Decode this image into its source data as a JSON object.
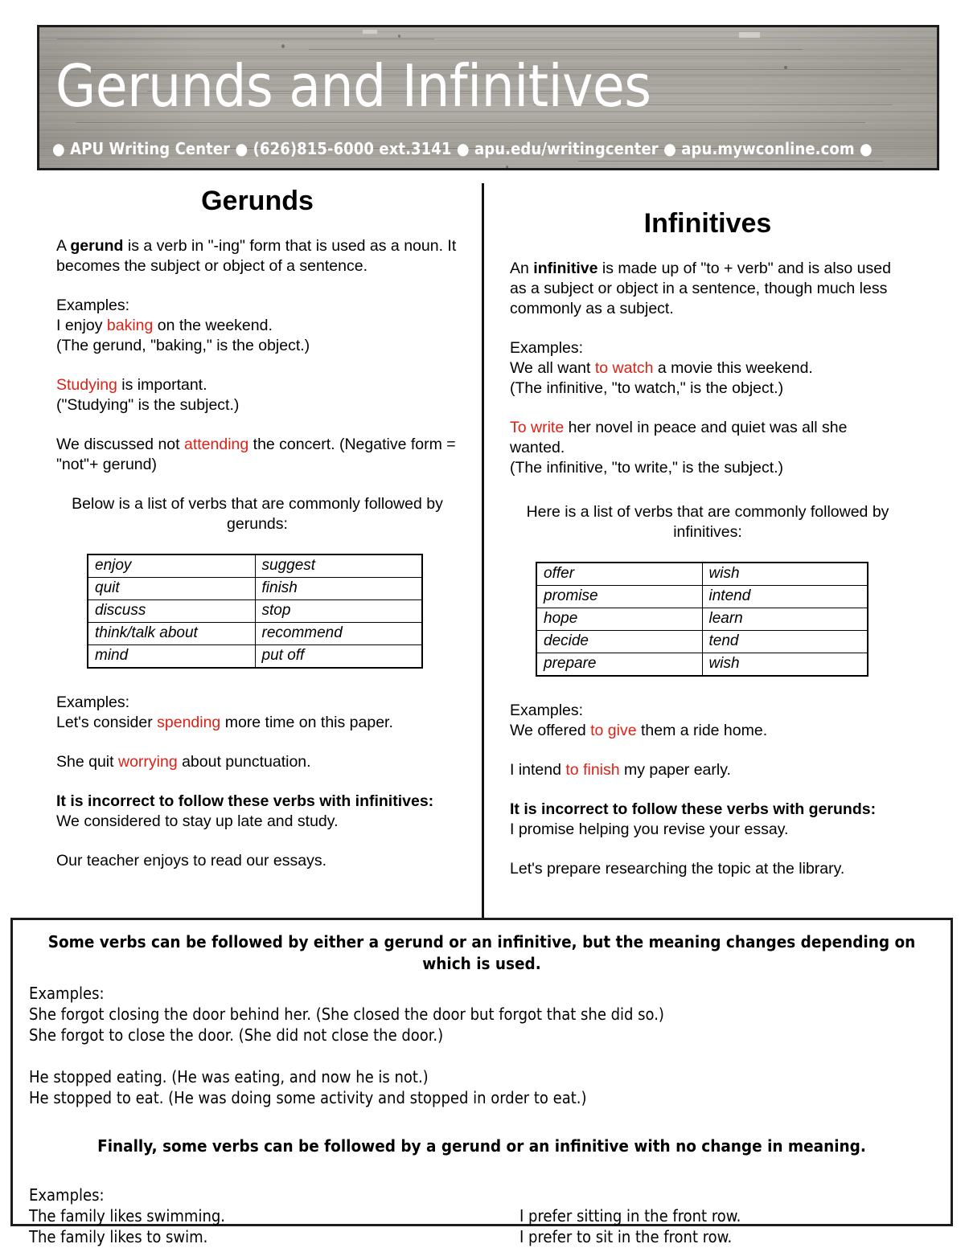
{
  "header": {
    "title": "Gerunds and Infinitives",
    "subtitle": "● APU Writing Center ● (626)815-6000 ext.3141 ● apu.edu/writingcenter ● apu.mywconline.com ●",
    "background_color": "#a9a5a0",
    "text_color": "#ffffff",
    "border_color": "#1c1c1c"
  },
  "accent": {
    "highlight_color": "#dd2116",
    "text_color": "#000000"
  },
  "gerunds": {
    "heading": "Gerunds",
    "definition_pre": "A ",
    "definition_bold": "gerund",
    "definition_post": " is a verb in \"-ing\" form that is used as a noun. It becomes the subject or object of a sentence.",
    "examples_label": "Examples:",
    "ex1_pre": "I enjoy ",
    "ex1_hl": "baking",
    "ex1_post": " on the weekend.",
    "ex1_note": "(The gerund, \"baking,\" is the object.)",
    "ex2_hl": "Studying",
    "ex2_post": " is important.",
    "ex2_note": "(\"Studying\" is the subject.)",
    "ex3_pre": "We discussed not ",
    "ex3_hl": "attending",
    "ex3_post": " the concert. (Negative form = \"not\"+ gerund)",
    "table_intro": "Below is a list of verbs that are commonly followed by gerunds:",
    "table": [
      [
        "enjoy",
        "suggest"
      ],
      [
        "quit",
        "finish"
      ],
      [
        "discuss",
        "stop"
      ],
      [
        "think/talk about",
        "recommend"
      ],
      [
        "mind",
        "put off"
      ]
    ],
    "examples2_label": "Examples:",
    "ex4_pre": "Let's consider ",
    "ex4_hl": "spending",
    "ex4_post": " more time on this paper.",
    "ex5_pre": "She quit ",
    "ex5_hl": "worrying",
    "ex5_post": " about punctuation.",
    "incorrect_heading": "It is incorrect to follow these verbs with infinitives:",
    "incorrect_ex1": "We considered to stay up late and study.",
    "incorrect_ex2": "Our teacher enjoys to read our essays."
  },
  "infinitives": {
    "heading": "Infinitives",
    "definition_pre": "An ",
    "definition_bold": "infinitive",
    "definition_post": " is made up of \"to + verb\" and is also used as a subject or object in a sentence, though much less commonly as a subject.",
    "examples_label": "Examples:",
    "ex1_pre": "We all want ",
    "ex1_hl": "to watch",
    "ex1_post": " a movie this weekend.",
    "ex1_note": "(The infinitive, \"to watch,\" is the object.)",
    "ex2_hl": "To write",
    "ex2_post": " her novel in peace and quiet was all she wanted.",
    "ex2_note": "(The infinitive, \"to write,\" is the subject.)",
    "table_intro": "Here is a list of verbs that are commonly followed by infinitives:",
    "table": [
      [
        "offer",
        "wish"
      ],
      [
        "promise",
        "intend"
      ],
      [
        "hope",
        "learn"
      ],
      [
        "decide",
        "tend"
      ],
      [
        "prepare",
        "wish"
      ]
    ],
    "examples2_label": "Examples:",
    "ex3_pre": "We offered ",
    "ex3_hl": "to give",
    "ex3_post": " them a ride home.",
    "ex4_pre": "I intend ",
    "ex4_hl": "to finish",
    "ex4_post": " my paper early.",
    "incorrect_heading": "It is incorrect to follow these verbs with gerunds:",
    "incorrect_ex1": "I promise helping you revise your essay.",
    "incorrect_ex2": "Let's prepare researching the topic at the library."
  },
  "bottom_box": {
    "heading": "Some verbs can be followed by either a gerund or an infinitive, but the meaning changes depending on which is used.",
    "examples_label": "Examples:",
    "line1": "She forgot closing the door behind her. (She closed the door but forgot that she did so.)",
    "line2": "She forgot to close the door. (She did not close the door.)",
    "line3": "He stopped eating. (He was eating, and now he is not.)",
    "line4": "He stopped to eat. (He was doing some activity and stopped in order to eat.)",
    "heading2": "Finally, some verbs can be followed by a gerund or an infinitive with no change in meaning.",
    "examples2_label": "Examples:",
    "left_line1": "The family likes swimming.",
    "left_line2": "The family likes to swim.",
    "right_line1": "I prefer sitting in the front row.",
    "right_line2": "I prefer to sit in the front row."
  }
}
